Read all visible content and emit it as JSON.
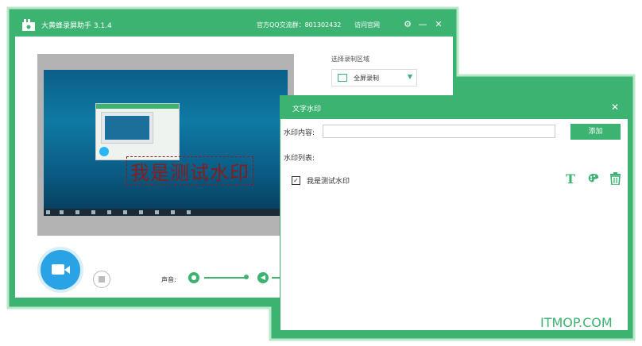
{
  "app": {
    "title": "大黄蜂录屏助手 3.1.4",
    "qq_group": "官方QQ交流群：801302432",
    "official_site": "访问官网"
  },
  "region": {
    "label": "选择录制区域",
    "selected": "全屏录制"
  },
  "preview": {
    "watermark_text": "我是测试水印"
  },
  "controls": {
    "volume_label": "声音:"
  },
  "dialog": {
    "title": "文字水印",
    "content_label": "水印内容:",
    "content_value": "",
    "add_label": "添加",
    "list_label": "水印列表:",
    "items": [
      {
        "text": "我是测试水印",
        "checked": true
      }
    ]
  },
  "brand": "ITMOP.COM",
  "colors": {
    "accent": "#3cb371",
    "record": "#29a3e6",
    "watermark": "#8b1a1a"
  },
  "icons": [
    "app-icon",
    "settings-icon",
    "minimize-icon",
    "close-icon",
    "monitor-icon",
    "chevron-down-icon",
    "camera-icon",
    "stop-icon",
    "mic-icon",
    "speaker-icon",
    "font-icon",
    "palette-icon",
    "trash-icon",
    "checkbox-icon"
  ]
}
